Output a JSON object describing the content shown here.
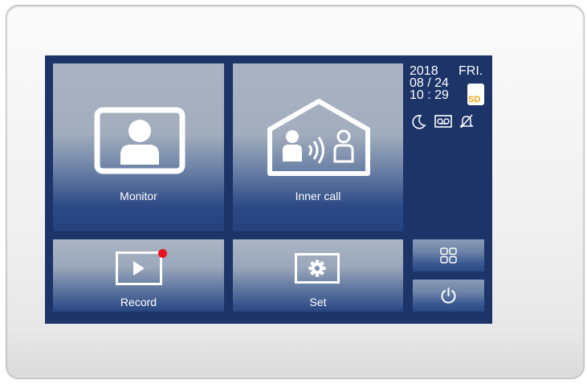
{
  "tiles": {
    "monitor": {
      "label": "Monitor"
    },
    "inner_call": {
      "label": "Inner call"
    },
    "record": {
      "label": "Record",
      "has_new_indicator": true
    },
    "set": {
      "label": "Set"
    }
  },
  "status": {
    "year": "2018",
    "weekday": "FRI.",
    "date": "08 / 24",
    "time": "10 : 29",
    "sd_label": "SD",
    "icons": [
      "moon-icon",
      "voicemail-icon",
      "bell-muted-icon"
    ]
  },
  "side_buttons": {
    "apps_icon": "grid-icon",
    "power_icon": "power-icon"
  },
  "colors": {
    "screen_bg": "#1c3468",
    "indicator": "#e8141f",
    "sd_text": "#f0a316"
  }
}
